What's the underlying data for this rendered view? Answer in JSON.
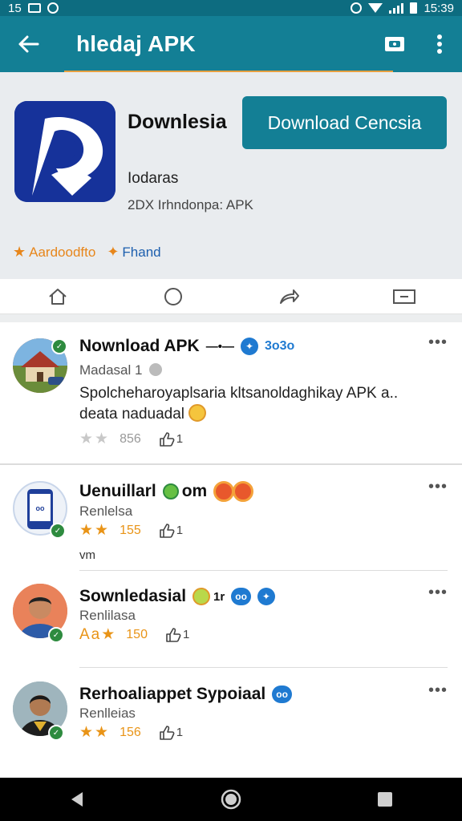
{
  "status_bar": {
    "left_text": "15",
    "time": "15:39"
  },
  "app_bar": {
    "title": "hledaj APK"
  },
  "hero": {
    "app_name": "Downlesia",
    "download_button": "Download Cencsia",
    "developer": "Iodaras",
    "meta": "2DX Irhndonpa: APK",
    "tags": [
      "Aardoodfto",
      "Fhand"
    ]
  },
  "colors": {
    "teal": "#137f95",
    "orange": "#e7a041",
    "blue": "#1f7ad1",
    "star": "#e99417"
  },
  "posts": [
    {
      "title": "Nownload APK",
      "title_suffix": "—•—",
      "badge": "3o3o",
      "subtitle": "Madasal 1",
      "body": "Spolcheharoyaplsaria kltsanoldaghikay APK a.. deata naduadal",
      "stars": "★★",
      "count": "856",
      "likes": "1",
      "more": "•••"
    },
    {
      "title": "Uenuillarl",
      "title_tail": "om",
      "subtitle": "Renlelsa",
      "stars": "★★",
      "count": "155",
      "likes": "1",
      "extra": "vm",
      "more": "•••"
    },
    {
      "title": "Sownledasial",
      "title_tail": "1r",
      "badge": "oo",
      "subtitle": "Renlilasa",
      "stars": "Aa★",
      "count": "150",
      "likes": "1",
      "more": "•••"
    },
    {
      "title": "Rerhoaliappet Sypoiaal",
      "badge": "oo",
      "subtitle": "Renlleias",
      "stars": "★★",
      "count": "156",
      "likes": "1",
      "more": "•••"
    }
  ]
}
